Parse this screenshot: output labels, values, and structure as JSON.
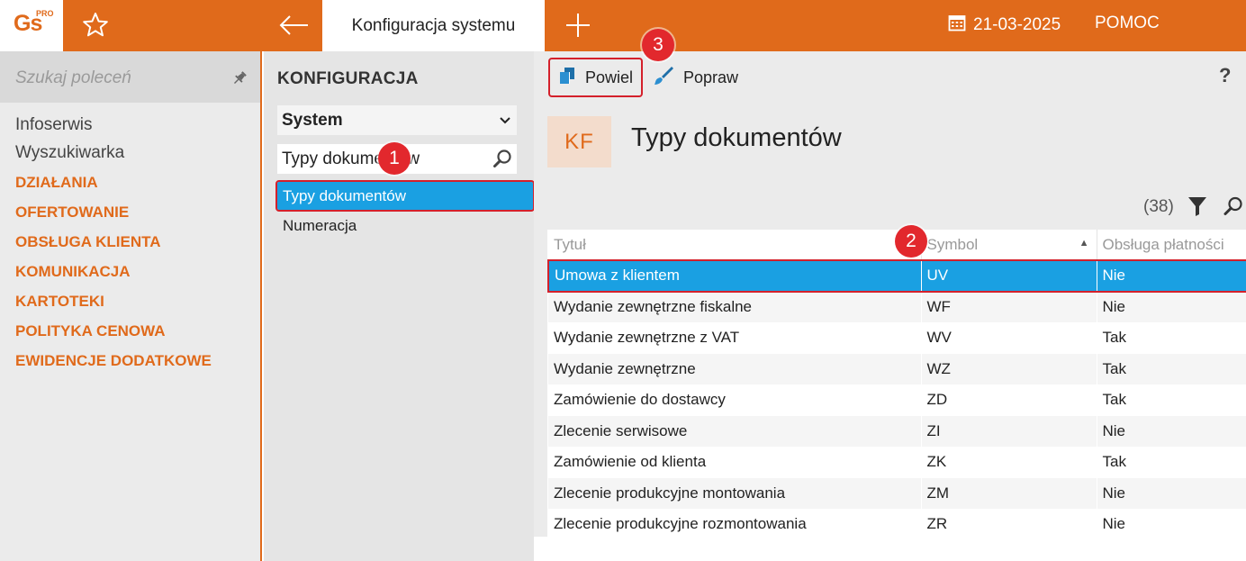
{
  "topbar": {
    "logo_text": "Gs",
    "logo_sup": "PRO",
    "active_tab_title": "Konfiguracja systemu",
    "date": "21-03-2025",
    "help_label": "POMOC",
    "accent_color": "#e06a1b"
  },
  "leftnav": {
    "search_placeholder": "Szukaj poleceń",
    "items": [
      {
        "label": "Infoserwis",
        "kind": "plain"
      },
      {
        "label": "Wyszukiwarka",
        "kind": "plain"
      },
      {
        "label": "DZIAŁANIA",
        "kind": "section"
      },
      {
        "label": "OFERTOWANIE",
        "kind": "section"
      },
      {
        "label": "OBSŁUGA KLIENTA",
        "kind": "section"
      },
      {
        "label": "KOMUNIKACJA",
        "kind": "section"
      },
      {
        "label": "KARTOTEKI",
        "kind": "section"
      },
      {
        "label": "POLITYKA CENOWA",
        "kind": "section"
      },
      {
        "label": "EWIDENCJE DODATKOWE",
        "kind": "section"
      }
    ]
  },
  "midpanel": {
    "title": "KONFIGURACJA",
    "select_value": "System",
    "filter_value": "Typy dokumentów",
    "items": [
      {
        "label": "Typy dokumentów",
        "selected": true
      },
      {
        "label": "Numeracja",
        "selected": false
      }
    ]
  },
  "toolbar": {
    "copy_label": "Powiel",
    "edit_label": "Popraw",
    "help_label": "?"
  },
  "main": {
    "badge": "KF",
    "title": "Typy dokumentów",
    "count": "(38)",
    "columns": [
      "Tytuł",
      "Symbol",
      "Obsługa płatności"
    ],
    "rows": [
      {
        "title": "Umowa z klientem",
        "symbol": "UV",
        "payment": "Nie",
        "selected": true
      },
      {
        "title": "Wydanie zewnętrzne fiskalne",
        "symbol": "WF",
        "payment": "Nie"
      },
      {
        "title": "Wydanie zewnętrzne z VAT",
        "symbol": "WV",
        "payment": "Tak"
      },
      {
        "title": "Wydanie zewnętrzne",
        "symbol": "WZ",
        "payment": "Tak"
      },
      {
        "title": "Zamówienie do dostawcy",
        "symbol": "ZD",
        "payment": "Tak"
      },
      {
        "title": "Zlecenie serwisowe",
        "symbol": "ZI",
        "payment": "Nie"
      },
      {
        "title": "Zamówienie od klienta",
        "symbol": "ZK",
        "payment": "Tak"
      },
      {
        "title": "Zlecenie produkcyjne montowania",
        "symbol": "ZM",
        "payment": "Nie"
      },
      {
        "title": "Zlecenie produkcyjne rozmontowania",
        "symbol": "ZR",
        "payment": "Nie"
      }
    ]
  },
  "steps": [
    "1",
    "2",
    "3"
  ]
}
